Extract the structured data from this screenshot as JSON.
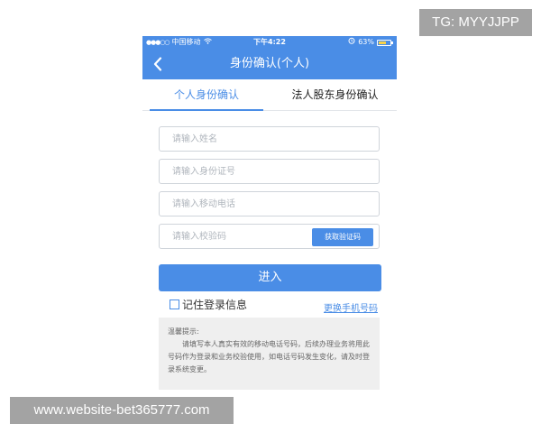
{
  "status_bar": {
    "carrier": "中国移动",
    "time": "下午4:22",
    "battery": "63%",
    "battery_level": 0.63
  },
  "navbar": {
    "back_icon": "chevron-left-icon",
    "title": "身份确认(个人)"
  },
  "tabs": [
    {
      "label": "个人身份确认",
      "active": true
    },
    {
      "label": "法人股东身份确认",
      "active": false
    }
  ],
  "form": {
    "name_placeholder": "请输入姓名",
    "id_placeholder": "请输入身份证号",
    "phone_placeholder": "请输入移动电话",
    "code_placeholder": "请输入校验码",
    "get_code_label": "获取验证码",
    "submit_label": "进入",
    "remember_label": "记住登录信息",
    "change_phone_label": "更换手机号码"
  },
  "tips": {
    "title": "温馨提示:",
    "body": "请填写本人真实有效的移动电话号码，后续办理业务将用此号码作为登录和业务校验使用，如电话号码发生变化，请及时登录系统变更。"
  },
  "colors": {
    "accent": "#4a8de6",
    "tips_background": "#efefef"
  },
  "overlays": {
    "tg_label": "TG: MYYJJPP",
    "website_label": "www.website-bet365777.com"
  }
}
